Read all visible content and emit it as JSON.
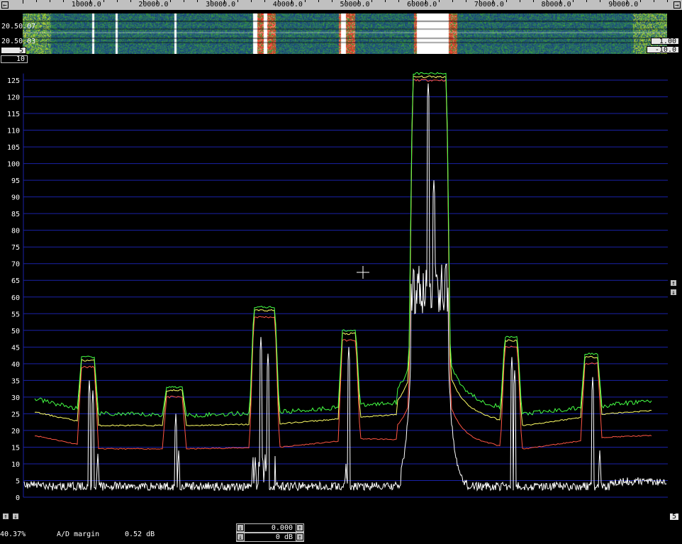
{
  "freq_ruler": {
    "labels": [
      "10000.0",
      "20000.0",
      "30000.0",
      "40000.0",
      "50000.0",
      "60000.0",
      "70000.0",
      "80000.0",
      "90000.0"
    ],
    "left_arrow": "←",
    "right_arrow": "→"
  },
  "waterfall": {
    "time_top": "20.50.07",
    "time_bottom": "20.50.03",
    "left_box": "5",
    "avg_box": "10",
    "right_gain": "1.00",
    "right_offset": "-10.0",
    "colors": {
      "bg": "#1d4a7a",
      "green": "#3a9a3a",
      "red": "#e03a2a",
      "white": "#ffffff"
    }
  },
  "spectrum": {
    "y_ticks": [
      "0",
      "5",
      "10",
      "15",
      "20",
      "25",
      "30",
      "35",
      "40",
      "45",
      "50",
      "55",
      "60",
      "65",
      "70",
      "75",
      "80",
      "85",
      "90",
      "95",
      "100",
      "105",
      "110",
      "115",
      "120",
      "125"
    ],
    "grid_color": "#1a22a8",
    "trace_colors": {
      "white": "#ffffff",
      "green": "#44ff44",
      "yellow": "#ffff66",
      "red": "#ff5544"
    },
    "scroll_up": "↑",
    "scroll_down": "↓",
    "right_box": "5"
  },
  "status": {
    "percent": "40.37%",
    "ad_label": "A/D margin",
    "ad_value": "0.52 dB"
  },
  "offset_control": {
    "value_top": "0.000",
    "value_bottom": "0 dB",
    "down_arrow": "↓",
    "up_arrow": "↑"
  }
}
